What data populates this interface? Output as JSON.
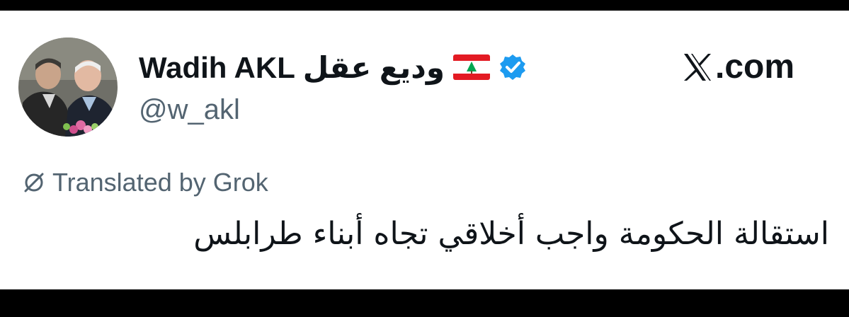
{
  "author": {
    "display_name": "Wadih AKL وديع عقل",
    "flag_icon": "lebanon-flag-icon",
    "verified_icon": "verified-badge-icon",
    "verified_color": "#1d9bf0",
    "handle": "@w_akl"
  },
  "brand": {
    "logo_icon": "x-logo-icon",
    "label": ".com"
  },
  "translation": {
    "icon": "translate-icon",
    "label": "Translated by Grok"
  },
  "tweet": {
    "text": "استقالة الحكومة واجب أخلاقي تجاه أبناء طرابلس"
  }
}
